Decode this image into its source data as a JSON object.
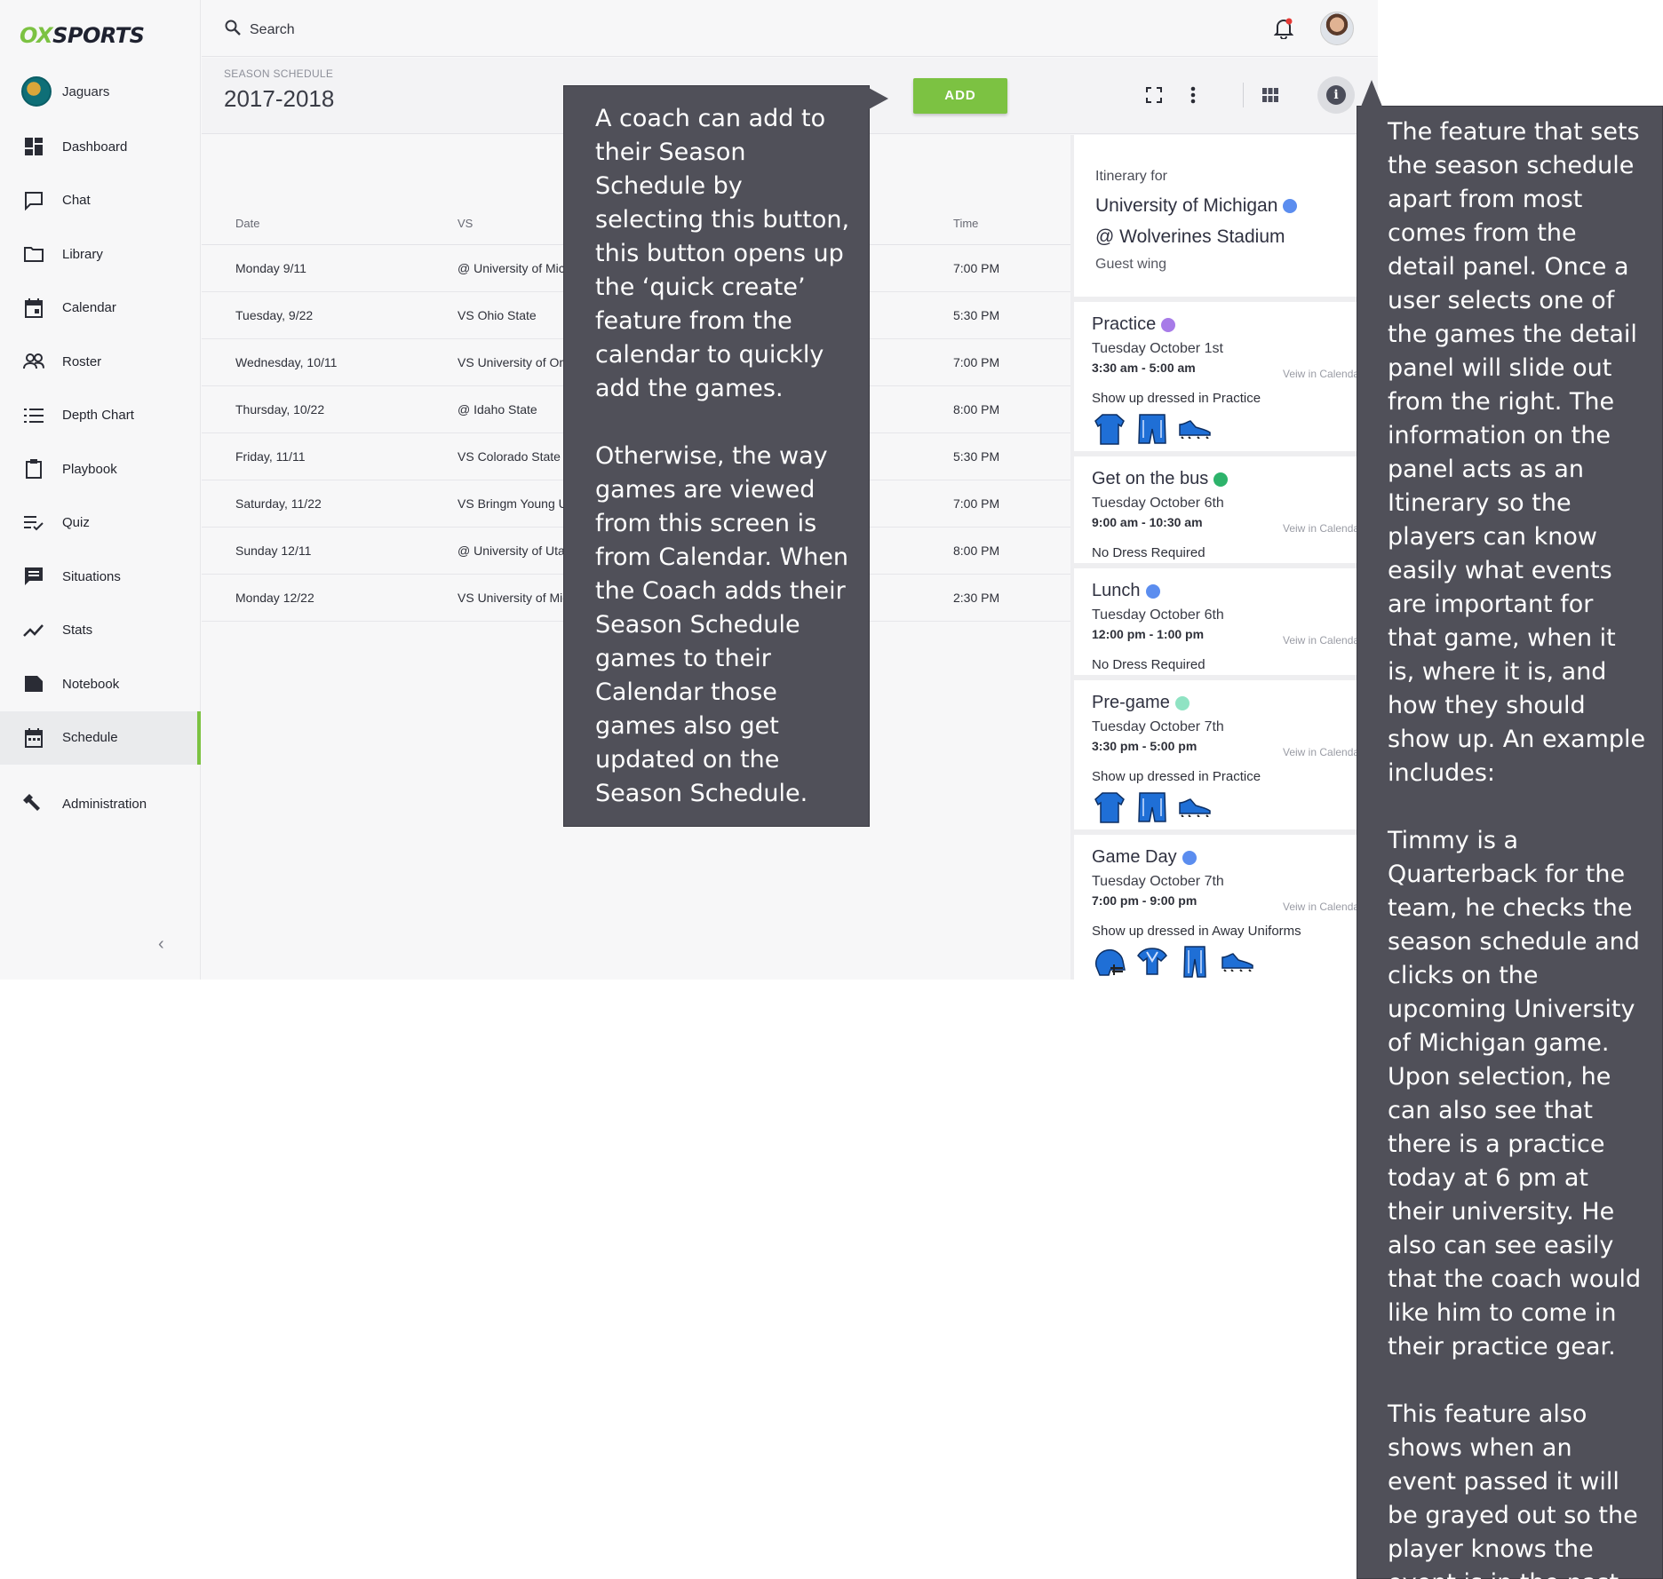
{
  "brand": {
    "ox": "OX",
    "sports": "SPORTS"
  },
  "team": {
    "name": "Jaguars"
  },
  "sidebar": {
    "items": [
      {
        "label": "Dashboard",
        "icon": "dashboard-icon"
      },
      {
        "label": "Chat",
        "icon": "chat-icon"
      },
      {
        "label": "Library",
        "icon": "folder-icon"
      },
      {
        "label": "Calendar",
        "icon": "calendar-icon"
      },
      {
        "label": "Roster",
        "icon": "people-icon"
      },
      {
        "label": "Depth Chart",
        "icon": "list-icon"
      },
      {
        "label": "Playbook",
        "icon": "clipboard-icon"
      },
      {
        "label": "Quiz",
        "icon": "checklist-icon"
      },
      {
        "label": "Situations",
        "icon": "message-list-icon"
      },
      {
        "label": "Stats",
        "icon": "trend-icon"
      },
      {
        "label": "Notebook",
        "icon": "notebook-icon"
      },
      {
        "label": "Schedule",
        "icon": "schedule-icon",
        "active": true
      }
    ],
    "admin_label": "Administration",
    "collapse_glyph": "‹"
  },
  "topbar": {
    "search_label": "Search"
  },
  "header": {
    "kicker": "SEASON SCHEDULE",
    "season": "2017-2018",
    "add_label": "ADD"
  },
  "table": {
    "headers": {
      "date": "Date",
      "vs": "VS",
      "time": "Time"
    },
    "rows": [
      {
        "date": "Monday 9/11",
        "vs": "@ University of Michigan",
        "time": "7:00 PM"
      },
      {
        "date": "Tuesday, 9/22",
        "vs": "VS Ohio State",
        "time": "5:30 PM"
      },
      {
        "date": "Wednesday, 10/11",
        "vs": "VS University of Oregon",
        "time": "7:00 PM"
      },
      {
        "date": "Thursday, 10/22",
        "vs": "@ Idaho State",
        "time": "8:00 PM"
      },
      {
        "date": "Friday, 11/11",
        "vs": "VS Colorado State",
        "time": "5:30 PM"
      },
      {
        "date": "Saturday, 11/22",
        "vs": "VS Bringm Young University",
        "time": "7:00 PM"
      },
      {
        "date": "Sunday 12/11",
        "vs": "@ University of Utah",
        "time": "8:00 PM"
      },
      {
        "date": "Monday 12/22",
        "vs": "VS University of Michigan",
        "time": "2:30 PM"
      }
    ]
  },
  "panel": {
    "itinerary_label": "Itinerary for",
    "opponent": "University of Michigan",
    "opponent_dot_color": "#5b8def",
    "venue": "@ Wolverines Stadium",
    "location_note": "Guest wing",
    "view_label": "Veiw in Calendar",
    "events": [
      {
        "name": "Practice",
        "dot_color": "#a77be8",
        "date": "Tuesday October 1st",
        "time": "3:30 am - 5:00 am",
        "dress": "Show up dressed in Practice",
        "gear": [
          "jersey-icon",
          "shorts-icon",
          "cleat-icon"
        ]
      },
      {
        "name": "Get on the bus",
        "dot_color": "#2db36b",
        "date": "Tuesday October 6th",
        "time": "9:00 am - 10:30 am",
        "dress": "No Dress Required",
        "gear": []
      },
      {
        "name": "Lunch",
        "dot_color": "#5b8def",
        "date": "Tuesday October 6th",
        "time": "12:00 pm - 1:00 pm",
        "dress": "No Dress Required",
        "gear": []
      },
      {
        "name": "Pre-game",
        "dot_color": "#8fe3c3",
        "date": "Tuesday October 7th",
        "time": "3:30 pm - 5:00 pm",
        "dress": "Show up dressed in Practice",
        "gear": [
          "jersey-icon",
          "shorts-icon",
          "cleat-icon"
        ]
      },
      {
        "name": "Game Day",
        "dot_color": "#5b8def",
        "date": "Tuesday October 7th",
        "time": "7:00 pm - 9:00 pm",
        "dress": "Show up dressed in Away Uniforms",
        "gear": [
          "helmet-icon",
          "shoulder-pads-icon",
          "pants-icon",
          "cleat-icon"
        ]
      }
    ]
  },
  "annotations": {
    "add_note": "A coach can add to their Season Schedule by selecting this button, this button opens up the ‘quick create’ feature from the calendar to quickly add the games.\n\nOtherwise, the way games are viewed from this screen is from Calendar. When the Coach adds their Season Schedule games to their Calendar those games also get updated on the Season Schedule.",
    "panel_note": "The feature that sets the season schedule apart from most comes from the detail panel. Once a user selects one of the games the detail panel will slide out from the right. The information on the panel acts as an Itinerary so the players can know easily what events are important for that game, when it is, where it is, and how they should show up. An example includes:\n\nTimmy is a Quarterback for the team, he checks the season schedule and clicks on the upcoming University of Michigan game. Upon selection, he can also see that there is a practice today at 6 pm at their university. He also can see easily that the coach would like him to come in their practice gear.\n\nThis feature also shows when an event passed it will be grayed out so the player knows the event is in the past."
  },
  "colors": {
    "accent": "#7cc242",
    "annotation_bg": "#505059",
    "gear_blue": "#1f6fd6"
  }
}
